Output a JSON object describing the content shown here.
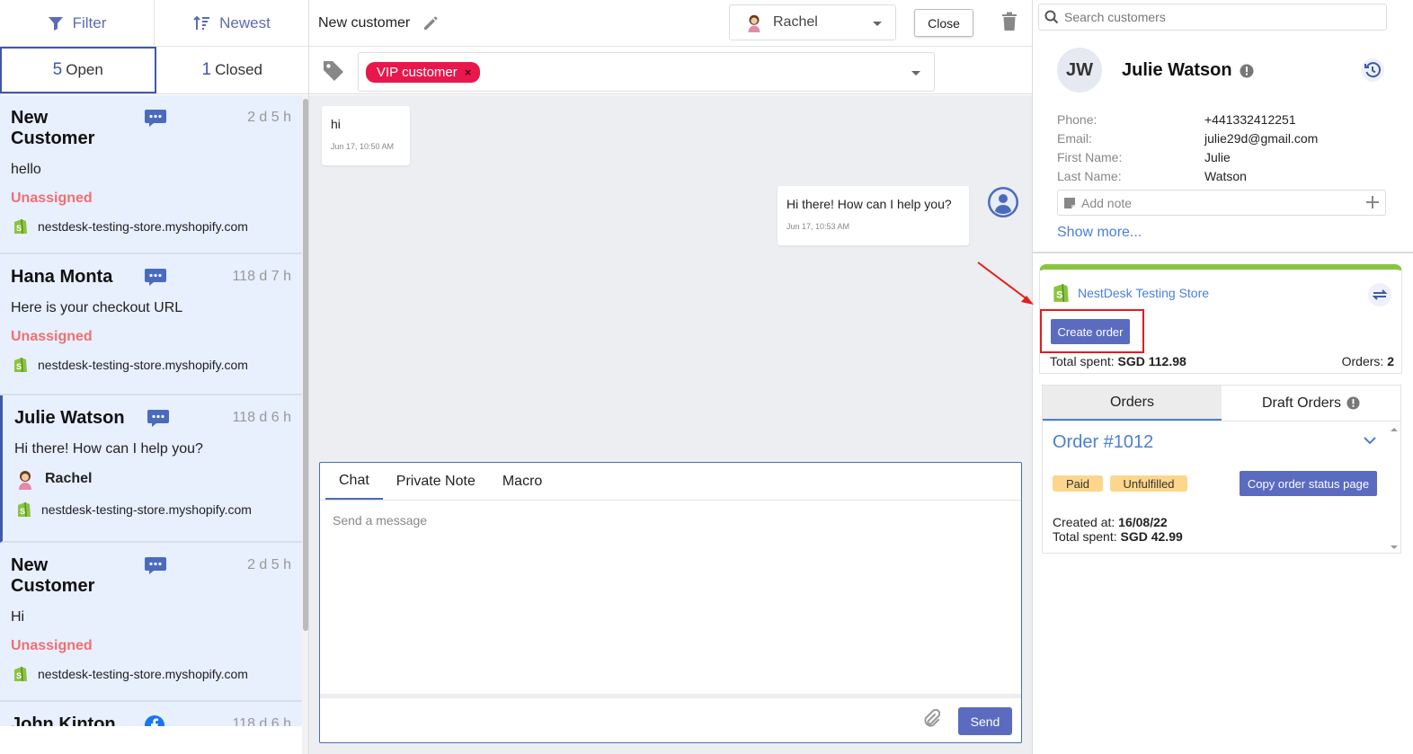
{
  "toolbar": {
    "filter_label": "Filter",
    "sort_label": "Newest"
  },
  "status_tabs": {
    "open": {
      "count": "5",
      "label": "Open"
    },
    "closed": {
      "count": "1",
      "label": "Closed"
    }
  },
  "conversations": [
    {
      "name": "New Customer",
      "message": "hello",
      "status": "Unassigned",
      "time": "2 d 5 h",
      "store": "nestdesk-testing-store.myshopify.com"
    },
    {
      "name": "Hana Monta",
      "message": "Here is your checkout URL",
      "status": "Unassigned",
      "time": "118 d 7 h",
      "store": "nestdesk-testing-store.myshopify.com"
    },
    {
      "name": "Julie Watson",
      "message": "Hi there! How can I help you?",
      "agent": "Rachel",
      "time": "118 d 6 h",
      "store": "nestdesk-testing-store.myshopify.com"
    },
    {
      "name": "New Customer",
      "message": "Hi",
      "status": "Unassigned",
      "time": "2 d 5 h",
      "store": "nestdesk-testing-store.myshopify.com"
    },
    {
      "name": "John Kinton",
      "time": "118 d 6 h"
    }
  ],
  "header": {
    "title": "New customer",
    "agent": "Rachel",
    "close_label": "Close"
  },
  "tags": {
    "vip_label": "VIP customer",
    "remove_glyph": "×"
  },
  "messages": [
    {
      "text": "hi",
      "time": "Jun 17, 10:50 AM"
    },
    {
      "text": "Hi there! How can I help you?",
      "time": "Jun 17, 10:53 AM"
    }
  ],
  "composer": {
    "tabs": [
      "Chat",
      "Private Note",
      "Macro"
    ],
    "placeholder": "Send a message",
    "send_label": "Send"
  },
  "search": {
    "placeholder": "Search customers"
  },
  "profile": {
    "initials": "JW",
    "name": "Julie Watson",
    "fields": [
      {
        "key": "Phone:",
        "value": "+441332412251"
      },
      {
        "key": "Email:",
        "value": "julie29d@gmail.com"
      },
      {
        "key": "First Name:",
        "value": "Julie"
      },
      {
        "key": "Last Name:",
        "value": "Watson"
      }
    ],
    "note_placeholder": "Add note",
    "show_more": "Show more..."
  },
  "store": {
    "name": "NestDesk Testing Store",
    "create_order_label": "Create order",
    "total_spent_label": "Total spent:",
    "total_spent_value": "SGD 112.98",
    "orders_label": "Orders:",
    "orders_value": "2"
  },
  "order_tabs": {
    "orders": "Orders",
    "draft": "Draft Orders"
  },
  "order": {
    "title": "Order #1012",
    "badges": [
      "Paid",
      "Unfulfilled"
    ],
    "copy_label": "Copy order status page",
    "created_label": "Created at:",
    "created_value": "16/08/22",
    "total_label": "Total spent:",
    "total_value": "SGD 42.99"
  },
  "colors": {
    "accent": "#5b6bc0",
    "link": "#4a7fd6",
    "vip": "#e8184c",
    "unassigned": "#f07070",
    "shopify": "#8ac43f",
    "highlight": "#e61b1b"
  }
}
